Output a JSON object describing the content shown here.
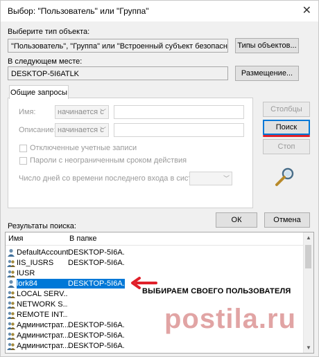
{
  "window": {
    "title": "Выбор: \"Пользователь\" или \"Группа\""
  },
  "object_type": {
    "label": "Выберите тип объекта:",
    "value": "\"Пользователь\", \"Группа\" или \"Встроенный субъект безопасности\"",
    "button": "Типы объектов..."
  },
  "location": {
    "label": "В следующем месте:",
    "value": "DESKTOP-5I6ATLK",
    "button": "Размещение..."
  },
  "tab": {
    "label": "Общие запросы"
  },
  "queries": {
    "name_label": "Имя:",
    "name_combo": "начинается с",
    "description_label": "Описание:",
    "description_combo": "начинается с",
    "disabled_accounts": "Отключенные учетные записи",
    "no_expire_passwords": "Пароли с неограниченным сроком действия",
    "days_label": "Число дней со времени последнего входа в систему:"
  },
  "buttons": {
    "columns": "Столбцы",
    "search": "Поиск",
    "stop": "Стоп",
    "ok": "ОК",
    "cancel": "Отмена"
  },
  "results": {
    "label": "Результаты поиска:",
    "col_name": "Имя",
    "col_folder": "В папке",
    "rows": [
      {
        "name": "DefaultAccount",
        "folder": "DESKTOP-5I6A..."
      },
      {
        "name": "IIS_IUSRS",
        "folder": "DESKTOP-5I6A..."
      },
      {
        "name": "IUSR",
        "folder": ""
      },
      {
        "name": "lork84",
        "folder": "DESKTOP-5I6A..."
      },
      {
        "name": "LOCAL SERV...",
        "folder": ""
      },
      {
        "name": "NETWORK S...",
        "folder": ""
      },
      {
        "name": "REMOTE INT...",
        "folder": ""
      },
      {
        "name": "Администрат...",
        "folder": "DESKTOP-5I6A..."
      },
      {
        "name": "Администрат...",
        "folder": "DESKTOP-5I6A..."
      },
      {
        "name": "Администрат...",
        "folder": "DESKTOP-5I6A..."
      }
    ]
  },
  "annotation": {
    "text": "ВЫБИРАЕМ СВОЕГО ПОЛЬЗОВАТЕЛЯ",
    "color": "#e0202a"
  },
  "watermark": {
    "text": "postila.ru"
  }
}
